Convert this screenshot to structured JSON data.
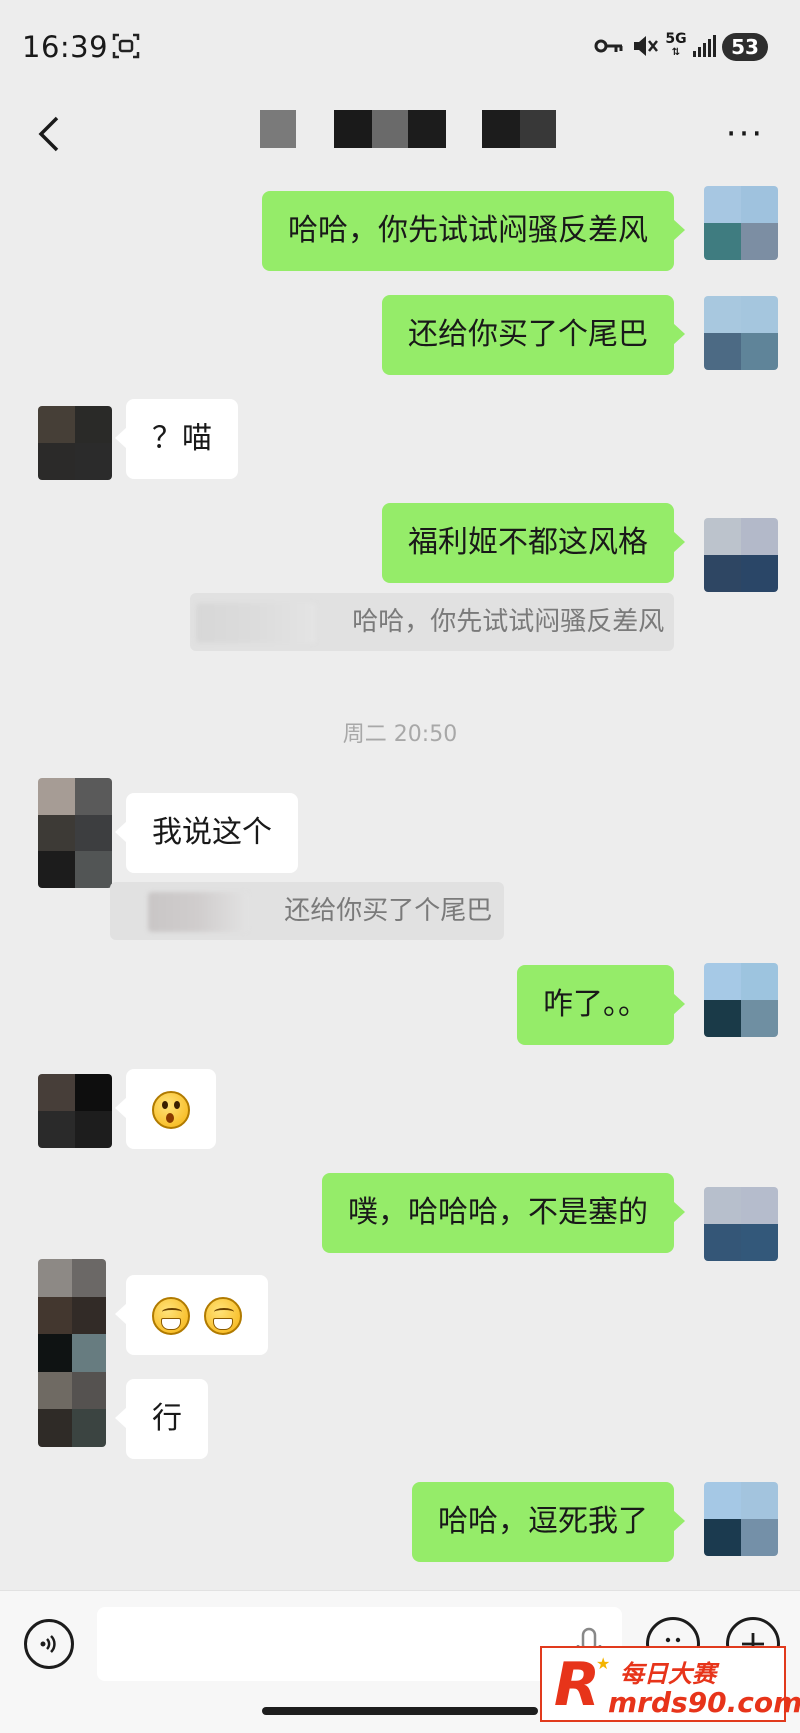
{
  "status": {
    "time": "16:39",
    "network": "5G",
    "battery": "53",
    "icons": [
      "screen-record-icon",
      "key-icon",
      "mute-icon",
      "network-5g-icon",
      "signal-icon",
      "battery-icon"
    ]
  },
  "header": {
    "back_icon": "chevron-left-icon",
    "more_label": "···"
  },
  "messages": [
    {
      "side": "right",
      "text": "哈哈，你先试试闷骚反差风"
    },
    {
      "side": "right",
      "text": "还给你买了个尾巴"
    },
    {
      "side": "left",
      "text": "？喵"
    },
    {
      "side": "right",
      "text": "福利姬不都这风格",
      "quote": "哈哈，你先试试闷骚反差风"
    },
    {
      "side": "left",
      "text": "我说这个",
      "quote": "还给你买了个尾巴"
    },
    {
      "side": "right",
      "text": "咋了。。"
    },
    {
      "side": "left",
      "emoji": "shocked-face-emoji"
    },
    {
      "side": "right",
      "text": "噗，哈哈哈，不是塞的"
    },
    {
      "side": "left",
      "emoji": "grin-face-emoji x2"
    },
    {
      "side": "left",
      "text": "行"
    },
    {
      "side": "right",
      "text": "哈哈，逗死我了"
    }
  ],
  "timestamp": "周二 20:50",
  "input": {
    "value": "",
    "placeholder": "",
    "voice_icon": "voice-icon",
    "mic_icon": "microphone-icon",
    "emoji_icon": "emoji-icon",
    "plus_icon": "plus-icon"
  },
  "watermark": {
    "logo": "R",
    "title": "每日大赛",
    "url": "mrds90.com"
  },
  "colors": {
    "background": "#ededed",
    "bubble_self": "#95ec69",
    "bubble_other": "#ffffff",
    "watermark_red": "#e7341a"
  }
}
